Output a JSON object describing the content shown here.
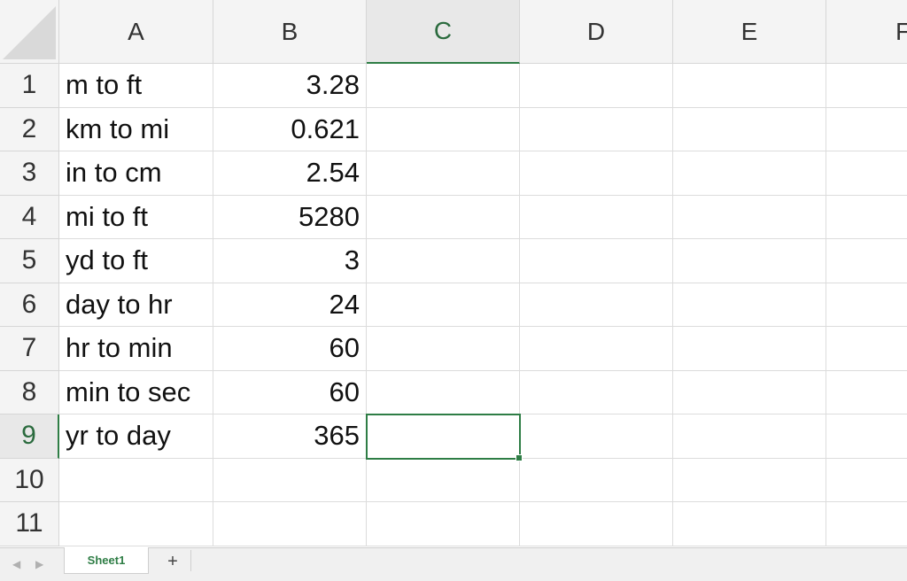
{
  "sheet": {
    "columns": [
      "A",
      "B",
      "C",
      "D",
      "E",
      "F"
    ],
    "active_column": "C",
    "active_row": 9,
    "rows": [
      {
        "num": "1",
        "a": "m to ft",
        "b": "3.28"
      },
      {
        "num": "2",
        "a": "km to mi",
        "b": "0.621"
      },
      {
        "num": "3",
        "a": "in to cm",
        "b": "2.54"
      },
      {
        "num": "4",
        "a": "mi to ft",
        "b": "5280"
      },
      {
        "num": "5",
        "a": "yd to ft",
        "b": "3"
      },
      {
        "num": "6",
        "a": "day to hr",
        "b": "24"
      },
      {
        "num": "7",
        "a": "hr to min",
        "b": "60"
      },
      {
        "num": "8",
        "a": "min to sec",
        "b": "60"
      },
      {
        "num": "9",
        "a": "yr to day",
        "b": "365"
      },
      {
        "num": "10",
        "a": "",
        "b": ""
      },
      {
        "num": "11",
        "a": "",
        "b": ""
      }
    ]
  },
  "tabs": {
    "prev_icon": "◀",
    "next_icon": "▶",
    "sheet_name": "Sheet1",
    "add_label": "+"
  },
  "colors": {
    "accent": "#2e7d45",
    "header_bg": "#f4f4f4",
    "gridline": "#dcdcdc"
  }
}
